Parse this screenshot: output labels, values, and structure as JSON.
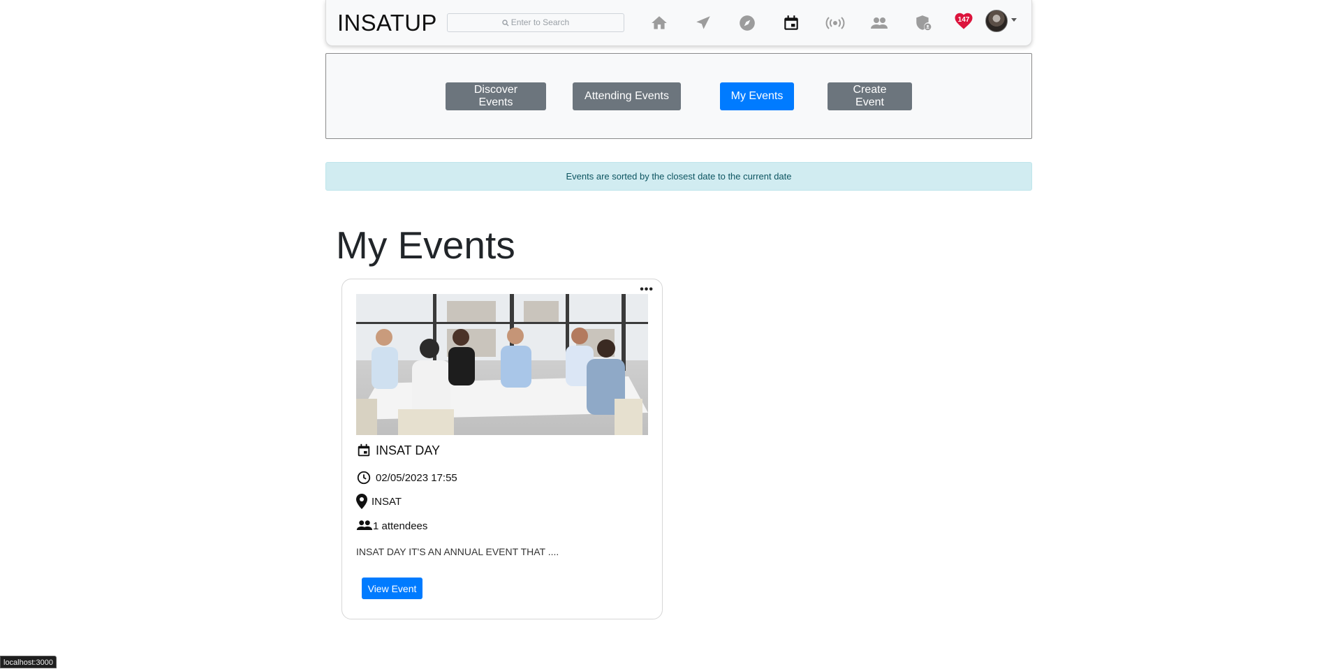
{
  "navbar": {
    "brand": "INSATUP",
    "search_placeholder": "Enter to Search",
    "icons": [
      "home-icon",
      "send-icon",
      "explore-icon",
      "calendar-icon",
      "broadcast-icon",
      "friends-icon",
      "admin-shield-icon",
      "heart-icon"
    ],
    "active_icon": "calendar-icon",
    "heart_count": "147"
  },
  "tabs": [
    {
      "label": "Discover Events",
      "active": false
    },
    {
      "label": "Attending Events",
      "active": false
    },
    {
      "label": "My Events",
      "active": true
    },
    {
      "label": "Create Event",
      "active": false
    }
  ],
  "alert": {
    "text": "Events are sorted by the closest date to the current date"
  },
  "main": {
    "title": "My Events"
  },
  "event_card": {
    "title": "INSAT DAY",
    "datetime": "02/05/2023 17:55",
    "location": "INSAT",
    "attendees": "1 attendees",
    "description": "INSAT DAY IT'S AN ANNUAL EVENT THAT ....",
    "button_label": "View Event",
    "menu_glyph": "•••"
  },
  "statusbar": {
    "url": "localhost:3000"
  },
  "colors": {
    "primary": "#007bff",
    "secondary": "#6c757d",
    "alert_bg": "#d1ecf1",
    "heart": "#dc143c"
  }
}
